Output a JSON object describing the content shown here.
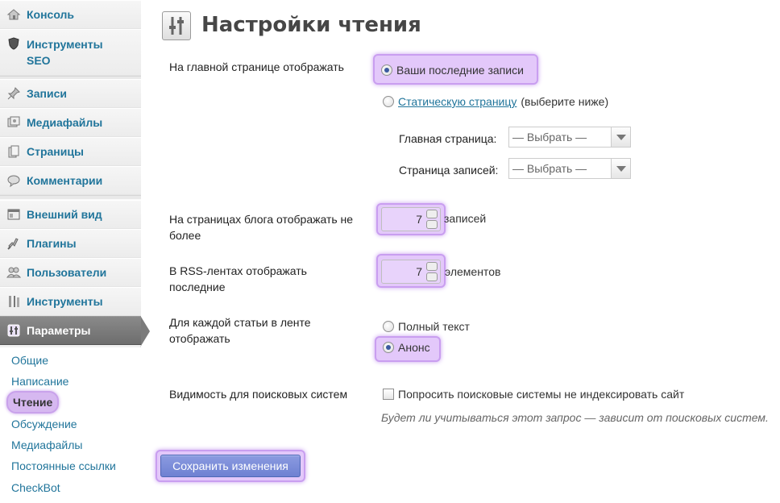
{
  "sidebar": {
    "menu": [
      {
        "label": "Консоль",
        "icon": "home-icon"
      },
      {
        "label": "Инструменты SEO",
        "icon": "shield-icon"
      },
      {
        "label": "Записи",
        "icon": "pin-icon"
      },
      {
        "label": "Медиафайлы",
        "icon": "media-icon"
      },
      {
        "label": "Страницы",
        "icon": "pages-icon"
      },
      {
        "label": "Комментарии",
        "icon": "comment-icon"
      },
      {
        "label": "Внешний вид",
        "icon": "appearance-icon"
      },
      {
        "label": "Плагины",
        "icon": "plugin-icon"
      },
      {
        "label": "Пользователи",
        "icon": "users-icon"
      },
      {
        "label": "Инструменты",
        "icon": "tools-icon"
      },
      {
        "label": "Параметры",
        "icon": "settings-icon"
      }
    ],
    "submenu": [
      "Общие",
      "Написание",
      "Чтение",
      "Обсуждение",
      "Медиафайлы",
      "Постоянные ссылки",
      "CheckBot"
    ]
  },
  "page": {
    "title": "Настройки чтения",
    "front_label": "На главной странице отображать",
    "front_latest": "Ваши последние записи",
    "front_static_link": "Статическую страницу",
    "front_static_hint": "(выберите ниже)",
    "home_page_label": "Главная страница:",
    "home_page_value": "— Выбрать —",
    "posts_page_label": "Страница записей:",
    "posts_page_value": "— Выбрать —",
    "blog_pages_label": "На страницах блога отображать не более",
    "blog_pages_value": "7",
    "blog_pages_suffix": "записей",
    "rss_label": "В RSS-лентах отображать последние",
    "rss_value": "7",
    "rss_suffix": "элементов",
    "feed_label": "Для каждой статьи в ленте отображать",
    "feed_full": "Полный текст",
    "feed_summary": "Анонс",
    "visibility_label": "Видимость для поисковых систем",
    "visibility_checkbox": "Попросить поисковые системы не индексировать сайт",
    "visibility_hint": "Будет ли учитываться этот запрос — зависит от поисковых систем.",
    "save_button": "Сохранить изменения"
  },
  "colors": {
    "link": "#21759b",
    "highlight": "#e3c8fa",
    "button": "#6e81d2"
  }
}
